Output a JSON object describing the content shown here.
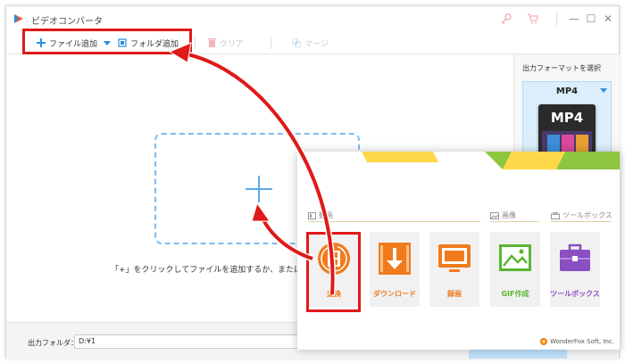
{
  "window": {
    "title": "ビデオコンバータ",
    "controls": {
      "minimize": "—",
      "maximize": "☐",
      "close": "✕"
    }
  },
  "toolbar": {
    "add_file": "ファイル追加",
    "add_folder": "フォルダ追加",
    "clear": "クリア",
    "merge": "マージ"
  },
  "main": {
    "hint": "「+」をクリックしてファイルを追加するか、またはフ"
  },
  "right_panel": {
    "title": "出力フォーマットを選択",
    "format": "MP4",
    "format_icon_text": "MP4"
  },
  "bottom": {
    "output_folder_label": "出力フォルダ：",
    "output_folder_value": "D:¥1"
  },
  "launcher": {
    "sections": {
      "video": "動画",
      "image": "画像",
      "toolbox": "ツールボックス"
    },
    "tiles": [
      {
        "label": "変換",
        "icon": "film-convert-icon",
        "color": "#f07b1e"
      },
      {
        "label": "ダウンロード",
        "icon": "download-icon",
        "color": "#f07b1e"
      },
      {
        "label": "録画",
        "icon": "screen-record-icon",
        "color": "#f07b1e"
      },
      {
        "label": "GIF作成",
        "icon": "gif-image-icon",
        "color": "#5cb531"
      },
      {
        "label": "ツールボックス",
        "icon": "toolbox-icon",
        "color": "#8a4fc1"
      }
    ],
    "brand": "WonderFox Soft, Inc."
  },
  "colors": {
    "accent_blue": "#2a8fe0",
    "highlight_red": "#e01919",
    "orange": "#f07b1e",
    "green": "#5cb531",
    "purple": "#8a4fc1"
  }
}
